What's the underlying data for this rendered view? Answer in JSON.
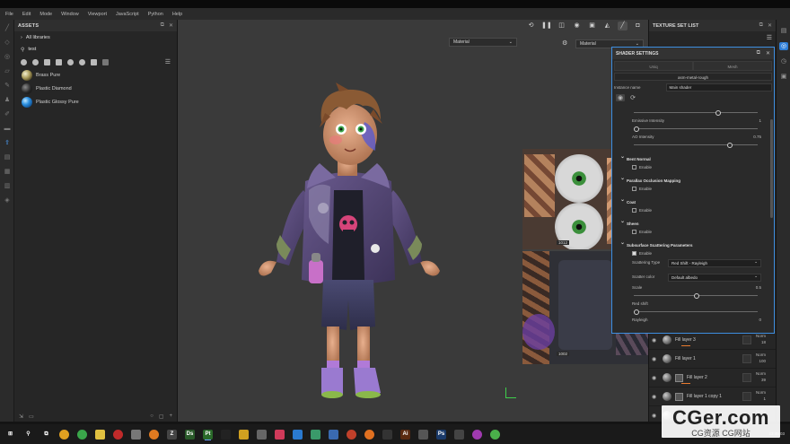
{
  "menu": [
    "File",
    "Edit",
    "Mode",
    "Window",
    "Viewport",
    "JavaScript",
    "Python",
    "Help"
  ],
  "assets": {
    "title": "ASSETS",
    "library": "All libraries",
    "search_value": "test",
    "items": [
      {
        "label": "Brass Pure",
        "icon": "brass-material-sphere"
      },
      {
        "label": "Plastic Diamond",
        "icon": "dark-material-sphere"
      },
      {
        "label": "Plastic Glossy Pure",
        "icon": "blue-material-sphere"
      }
    ]
  },
  "viewport": {
    "material_dropdown_left": "Material",
    "material_dropdown_right": "Material",
    "uv_num_a": "1012",
    "uv_num_b": "1002"
  },
  "texture_set_list": {
    "title": "TEXTURE SET LIST",
    "layers": [
      {
        "name": "Fill layer 3",
        "blend": "Norm",
        "opacity": "18"
      },
      {
        "name": "Fill layer 1",
        "blend": "Norm",
        "opacity": "100"
      },
      {
        "name": "Fill layer 2",
        "blend": "Norm",
        "opacity": "39"
      },
      {
        "name": "Fill layer 1 copy 1",
        "blend": "Norm",
        "opacity": "1"
      },
      {
        "name": "",
        "blend": "Norm",
        "opacity": ""
      }
    ]
  },
  "shader_settings": {
    "title": "SHADER SETTINGS",
    "tab_left": "Uniq",
    "tab_right": "Mesh",
    "shader_name": "asm-metal-rough",
    "instance_label": "Instance name",
    "instance_value": "Main shader",
    "emissive_label": "Emissive Intensity",
    "emissive_value": "1",
    "ao_label": "AO Intensity",
    "ao_value": "0.75",
    "ao_fraction": 0.75,
    "emissive_fraction": 0.6,
    "sections": {
      "bent_normal": "Bent Normal",
      "parallax": "Parallax Occlusion Mapping",
      "coat": "Coat",
      "sheen": "Sheen",
      "sss": "Subsurface Scattering Parameters"
    },
    "enable_label": "Enable",
    "scattering_type_label": "Scattering Type",
    "scattering_type_value": "Red Shift - Rayleigh",
    "scatter_color_label": "Scatter color",
    "scatter_color_value": "Default albedo",
    "scale_label": "Scale",
    "scale_value": "0.5",
    "scale_fraction": 0.5,
    "red_shift_label": "Red shift",
    "rayleigh_label": "Rayleigh",
    "rayleigh_value": "0",
    "red_shift_fraction": 0.0
  },
  "taskbar": {
    "time": "23:45:03"
  },
  "watermark": {
    "main": "CGer.com",
    "sub": "CG资源 CG网站"
  },
  "colors": {
    "accent": "#2f7fd8",
    "panel": "#262626",
    "viewport_bg": "#3a3a3a",
    "opacity_bar": "#e87a2e"
  }
}
